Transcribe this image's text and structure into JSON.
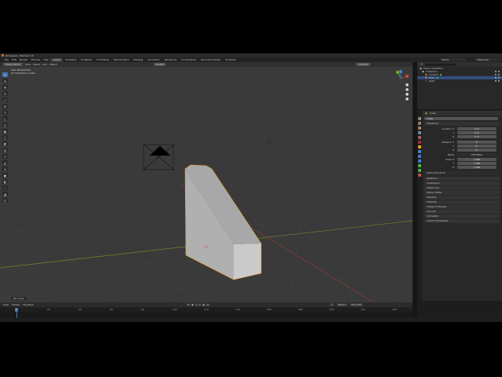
{
  "window": {
    "title": "[Unsaved] - Blender 3.6"
  },
  "menu": {
    "items": [
      "File",
      "Edit",
      "Render",
      "Window",
      "Help"
    ]
  },
  "workspaces": [
    "Layout",
    "Modeling",
    "Sculpting",
    "UV Editing",
    "Texture Paint",
    "Shading",
    "Animation",
    "Rendering",
    "Compositing",
    "Geometry Nodes",
    "Scripting"
  ],
  "scene": {
    "label": "Scene",
    "view_layer": "ViewLayer"
  },
  "viewport": {
    "header": {
      "mode": "Object Mode",
      "menus": [
        "View",
        "Select",
        "Add",
        "Object"
      ],
      "orientation": "Global",
      "options_label": "Options"
    },
    "overlay_line1": "User Perspective",
    "overlay_line2": "(1) Collection | Cube",
    "tools": [
      "cursor",
      "select",
      "move",
      "rotate",
      "scale",
      "transform",
      "annotate",
      "measure",
      "add-cube"
    ],
    "colors": {
      "background": "#3a3a3a",
      "grid": "#444444",
      "x_axis": "#8b3a3a",
      "y_axis": "#6b8a2a",
      "mesh": "#b8b8b8",
      "selection": "#e8a030"
    }
  },
  "outliner": {
    "title": "Scene Collection",
    "rows": [
      {
        "name": "Collection",
        "indent": 1
      },
      {
        "name": "Camera",
        "indent": 2
      },
      {
        "name": "Cube",
        "indent": 2,
        "selected": true
      },
      {
        "name": "Light",
        "indent": 2
      }
    ]
  },
  "properties": {
    "object_name": "Cube",
    "header": "Cube",
    "sections": {
      "transform": "Transform",
      "location_label": "Location X",
      "rotation_label": "Rotation X",
      "mode_label": "Mode",
      "mode_value": "XYZ Euler",
      "scale_label": "Scale X",
      "y": "Y",
      "z": "Z",
      "location": [
        "0 m",
        "0 m",
        "0 m"
      ],
      "rotation": [
        "0°",
        "0°",
        "0°"
      ],
      "scale": [
        "1.000",
        "1.000",
        "1.000"
      ],
      "delta": "Delta Transform"
    },
    "panels": [
      "Relations",
      "Collections",
      "Instancing",
      "Motion Paths",
      "Shading",
      "Visibility",
      "Viewport Display",
      "Line Art",
      "Animation",
      "Custom Properties"
    ]
  },
  "timeline": {
    "menus": [
      "View",
      "Marker",
      "Playback"
    ],
    "start_label": "Start",
    "start": "1",
    "end_label": "End",
    "end": "250",
    "current_frame": "1",
    "ticks": [
      "0",
      "20",
      "40",
      "60",
      "80",
      "100",
      "120",
      "140",
      "160",
      "180",
      "200",
      "220",
      "240"
    ]
  },
  "status": {
    "text": "Pan View"
  }
}
